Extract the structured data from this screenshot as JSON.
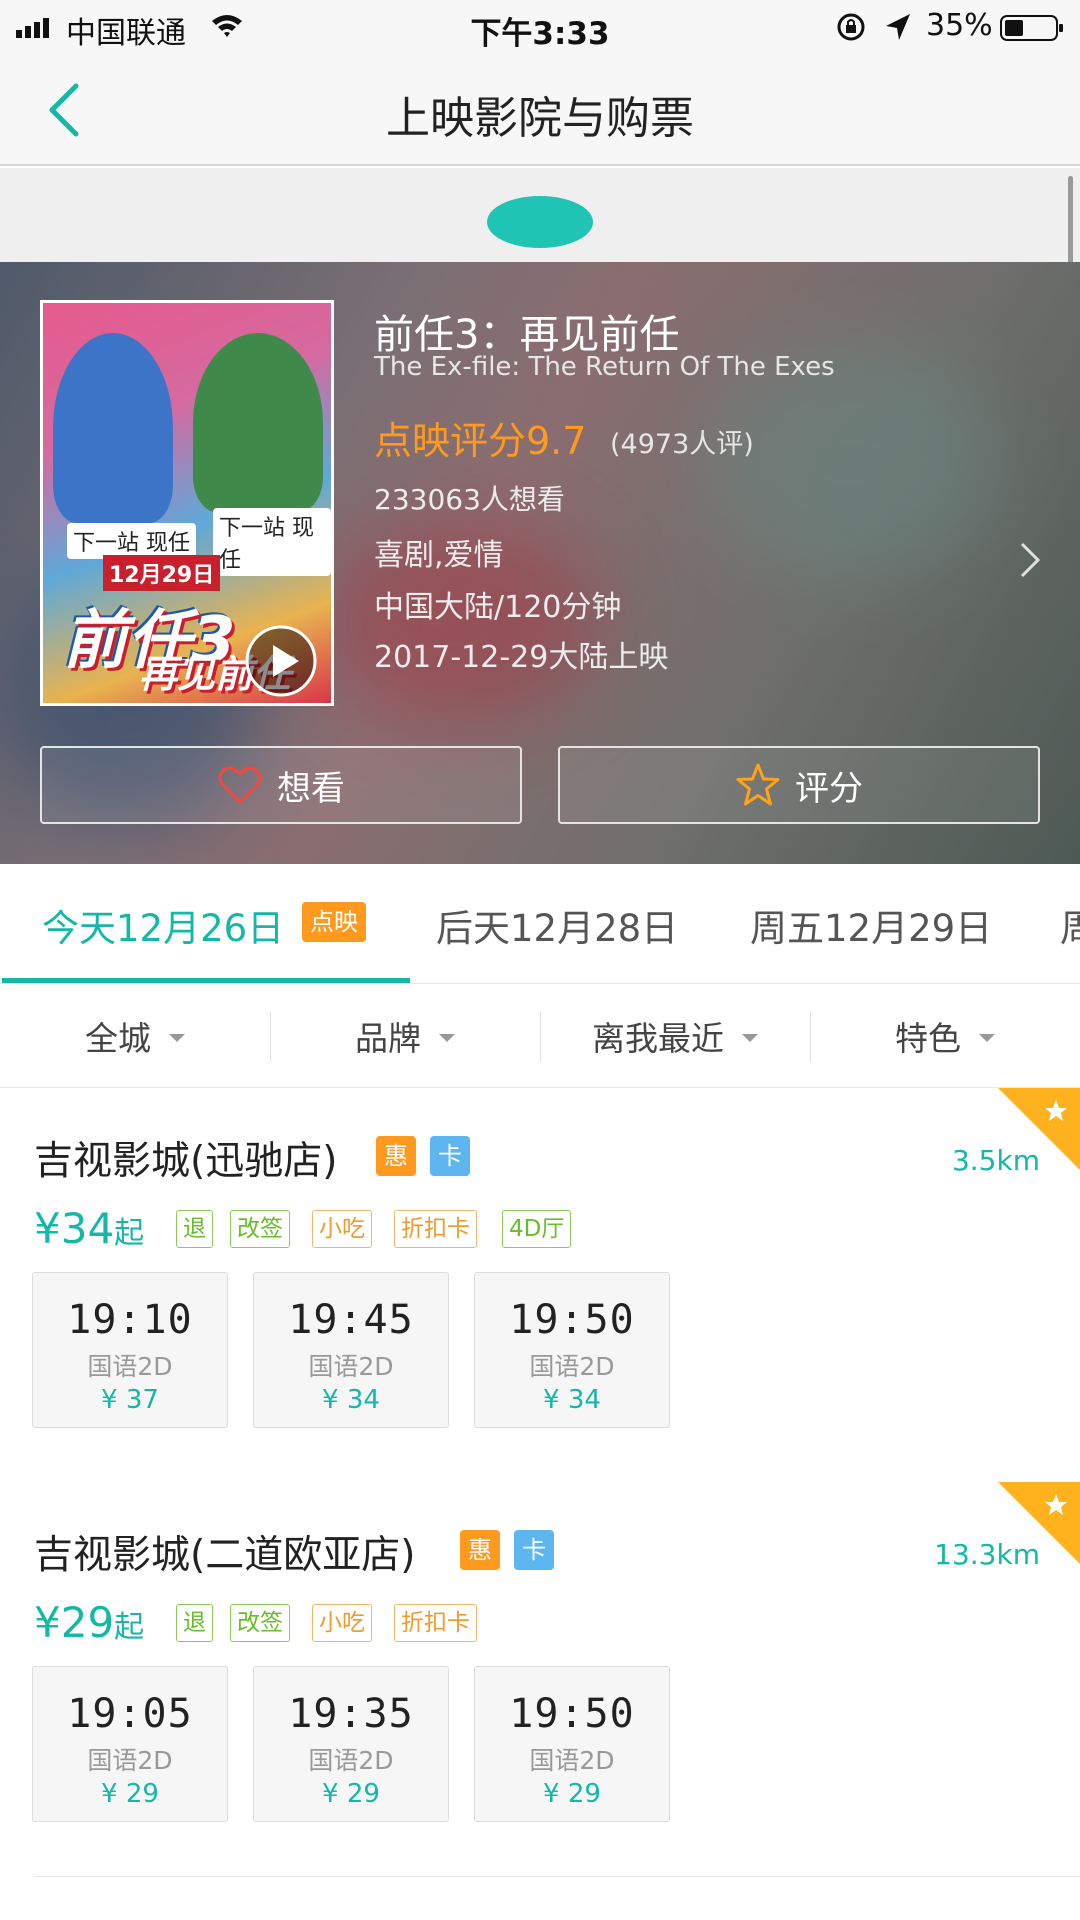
{
  "status_bar": {
    "carrier": "中国联通",
    "time": "下午3:33",
    "battery": "35%"
  },
  "nav": {
    "title": "上映影院与购票"
  },
  "movie": {
    "name": "前任3：再见前任",
    "name_en": "The Ex-file: The Return Of The Exes",
    "rating": "点映评分9.7",
    "rating_count": "(4973人评)",
    "want_count": "233063人想看",
    "genre": "喜剧,爱情",
    "region_duration": "中国大陆/120分钟",
    "release": "2017-12-29大陆上映",
    "poster": {
      "title": "前任3",
      "subtitle": "再见前任",
      "date_banner": "12月29日",
      "tag_left": "下一站 现任",
      "tag_right": "下一站 现任"
    },
    "want_button": "想看",
    "rate_button": "评分"
  },
  "date_tabs": [
    {
      "label": "今天12月26日",
      "active": true
    },
    {
      "label": "后天12月28日",
      "active": false
    },
    {
      "label": "周五12月29日",
      "active": false
    },
    {
      "label": "周",
      "active": false
    }
  ],
  "date_badge": "点映",
  "filters": [
    {
      "label": "全城"
    },
    {
      "label": "品牌"
    },
    {
      "label": "离我最近"
    },
    {
      "label": "特色"
    }
  ],
  "cinemas": [
    {
      "name": "吉视影城(迅驰店)",
      "badge_hui": "惠",
      "badge_ka": "卡",
      "distance": "3.5km",
      "price": "¥34",
      "price_suffix": "起",
      "tags": [
        {
          "label": "退",
          "color": "green"
        },
        {
          "label": "改签",
          "color": "green"
        },
        {
          "label": "小吃",
          "color": "orange"
        },
        {
          "label": "折扣卡",
          "color": "orange"
        },
        {
          "label": "4D厅",
          "color": "green"
        }
      ],
      "showtimes": [
        {
          "time": "19:10",
          "lang": "国语2D",
          "price": "¥ 37"
        },
        {
          "time": "19:45",
          "lang": "国语2D",
          "price": "¥ 34"
        },
        {
          "time": "19:50",
          "lang": "国语2D",
          "price": "¥ 34"
        }
      ]
    },
    {
      "name": "吉视影城(二道欧亚店)",
      "badge_hui": "惠",
      "badge_ka": "卡",
      "distance": "13.3km",
      "price": "¥29",
      "price_suffix": "起",
      "tags": [
        {
          "label": "退",
          "color": "green"
        },
        {
          "label": "改签",
          "color": "green"
        },
        {
          "label": "小吃",
          "color": "orange"
        },
        {
          "label": "折扣卡",
          "color": "orange"
        }
      ],
      "showtimes": [
        {
          "time": "19:05",
          "lang": "国语2D",
          "price": "¥ 29"
        },
        {
          "time": "19:35",
          "lang": "国语2D",
          "price": "¥ 29"
        },
        {
          "time": "19:50",
          "lang": "国语2D",
          "price": "¥ 29"
        }
      ]
    }
  ],
  "colors": {
    "accent": "#14b8a6",
    "rating": "#ff9a1e"
  }
}
